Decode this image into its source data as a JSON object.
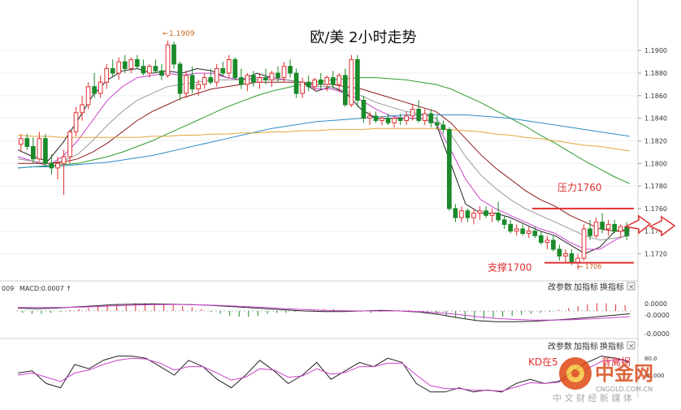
{
  "chart_data": {
    "type": "candlestick",
    "title": "欧/美 2小时走势",
    "y_axis_ticks": [
      "1.1900",
      "1.1880",
      "1.1860",
      "1.1840",
      "1.1820",
      "1.1800",
      "1.1780",
      "1.1760",
      "1.1740",
      "1.1720"
    ],
    "ylim": [
      1.1706,
      1.1916
    ],
    "high_label": "1.1909",
    "low_label": "1706",
    "candles_ohlc": [
      [
        1.1817,
        1.1826,
        1.181,
        1.1822
      ],
      [
        1.1822,
        1.1826,
        1.1812,
        1.1815
      ],
      [
        1.1815,
        1.1823,
        1.18,
        1.1804
      ],
      [
        1.1804,
        1.1828,
        1.1802,
        1.1822
      ],
      [
        1.1822,
        1.1826,
        1.1798,
        1.18
      ],
      [
        1.18,
        1.1808,
        1.179,
        1.1796
      ],
      [
        1.1796,
        1.1806,
        1.1786,
        1.18
      ],
      [
        1.18,
        1.1812,
        1.1772,
        1.1806
      ],
      [
        1.1806,
        1.183,
        1.18,
        1.1828
      ],
      [
        1.1828,
        1.185,
        1.1824,
        1.1845
      ],
      [
        1.1845,
        1.186,
        1.1838,
        1.1852
      ],
      [
        1.1852,
        1.1872,
        1.1848,
        1.1868
      ],
      [
        1.1868,
        1.188,
        1.1858,
        1.1862
      ],
      [
        1.1862,
        1.1878,
        1.1858,
        1.1872
      ],
      [
        1.1872,
        1.1888,
        1.1866,
        1.1884
      ],
      [
        1.1884,
        1.1892,
        1.1876,
        1.188
      ],
      [
        1.188,
        1.1894,
        1.1874,
        1.189
      ],
      [
        1.189,
        1.1896,
        1.188,
        1.1884
      ],
      [
        1.1884,
        1.1894,
        1.188,
        1.1892
      ],
      [
        1.1892,
        1.1896,
        1.1884,
        1.1886
      ],
      [
        1.1886,
        1.1892,
        1.1878,
        1.188
      ],
      [
        1.188,
        1.1888,
        1.1876,
        1.1886
      ],
      [
        1.1886,
        1.1892,
        1.188,
        1.1882
      ],
      [
        1.1882,
        1.1888,
        1.1874,
        1.1878
      ],
      [
        1.1878,
        1.1909,
        1.1876,
        1.1905
      ],
      [
        1.1905,
        1.1908,
        1.1884,
        1.1888
      ],
      [
        1.1888,
        1.189,
        1.1856,
        1.1862
      ],
      [
        1.1862,
        1.1882,
        1.1858,
        1.1878
      ],
      [
        1.1878,
        1.1886,
        1.1862,
        1.1866
      ],
      [
        1.1866,
        1.1874,
        1.186,
        1.187
      ],
      [
        1.187,
        1.188,
        1.1866,
        1.1876
      ],
      [
        1.1876,
        1.1884,
        1.187,
        1.1872
      ],
      [
        1.1872,
        1.1888,
        1.1868,
        1.1884
      ],
      [
        1.1884,
        1.189,
        1.1878,
        1.188
      ],
      [
        1.188,
        1.1896,
        1.1876,
        1.1892
      ],
      [
        1.1892,
        1.1894,
        1.1874,
        1.1876
      ],
      [
        1.1876,
        1.1884,
        1.1866,
        1.187
      ],
      [
        1.187,
        1.188,
        1.1864,
        1.1878
      ],
      [
        1.1878,
        1.1882,
        1.1868,
        1.1872
      ],
      [
        1.1872,
        1.188,
        1.1866,
        1.1876
      ],
      [
        1.1876,
        1.1884,
        1.187,
        1.1874
      ],
      [
        1.1874,
        1.1882,
        1.1868,
        1.188
      ],
      [
        1.188,
        1.1886,
        1.1872,
        1.1876
      ],
      [
        1.1876,
        1.189,
        1.1872,
        1.1886
      ],
      [
        1.1886,
        1.1892,
        1.1876,
        1.188
      ],
      [
        1.188,
        1.1884,
        1.1858,
        1.1862
      ],
      [
        1.1862,
        1.1876,
        1.1858,
        1.1872
      ],
      [
        1.1872,
        1.1878,
        1.1864,
        1.1868
      ],
      [
        1.1868,
        1.1876,
        1.1864,
        1.1874
      ],
      [
        1.1874,
        1.188,
        1.1866,
        1.187
      ],
      [
        1.187,
        1.1878,
        1.1864,
        1.1876
      ],
      [
        1.1876,
        1.1882,
        1.1866,
        1.187
      ],
      [
        1.187,
        1.188,
        1.1864,
        1.1878
      ],
      [
        1.1878,
        1.1884,
        1.185,
        1.1852
      ],
      [
        1.1852,
        1.1896,
        1.185,
        1.1892
      ],
      [
        1.1892,
        1.1896,
        1.185,
        1.1856
      ],
      [
        1.1856,
        1.186,
        1.1836,
        1.184
      ],
      [
        1.184,
        1.1846,
        1.1834,
        1.1842
      ],
      [
        1.1842,
        1.1846,
        1.1836,
        1.1838
      ],
      [
        1.1838,
        1.1842,
        1.1834,
        1.184
      ],
      [
        1.184,
        1.1844,
        1.1834,
        1.1836
      ],
      [
        1.1836,
        1.1842,
        1.1832,
        1.184
      ],
      [
        1.184,
        1.1844,
        1.1834,
        1.1838
      ],
      [
        1.1838,
        1.1846,
        1.1834,
        1.1842
      ],
      [
        1.1842,
        1.1852,
        1.1838,
        1.1848
      ],
      [
        1.1848,
        1.1856,
        1.1836,
        1.1838
      ],
      [
        1.1838,
        1.1848,
        1.1834,
        1.1844
      ],
      [
        1.1844,
        1.1848,
        1.1832,
        1.1836
      ],
      [
        1.1836,
        1.1842,
        1.183,
        1.1834
      ],
      [
        1.1834,
        1.1838,
        1.1826,
        1.183
      ],
      [
        1.183,
        1.1832,
        1.1758,
        1.176
      ],
      [
        1.176,
        1.1764,
        1.1748,
        1.1752
      ],
      [
        1.1752,
        1.1762,
        1.1748,
        1.1758
      ],
      [
        1.1758,
        1.176,
        1.1748,
        1.1752
      ],
      [
        1.1752,
        1.176,
        1.1746,
        1.1756
      ],
      [
        1.1756,
        1.1762,
        1.175,
        1.1758
      ],
      [
        1.1758,
        1.1762,
        1.1752,
        1.1754
      ],
      [
        1.1754,
        1.176,
        1.1748,
        1.1756
      ],
      [
        1.1756,
        1.1766,
        1.1748,
        1.175
      ],
      [
        1.175,
        1.1754,
        1.1742,
        1.1746
      ],
      [
        1.1746,
        1.175,
        1.1738,
        1.174
      ],
      [
        1.174,
        1.1746,
        1.1736,
        1.1742
      ],
      [
        1.1742,
        1.1746,
        1.1736,
        1.1738
      ],
      [
        1.1738,
        1.1744,
        1.1734,
        1.174
      ],
      [
        1.174,
        1.1744,
        1.1734,
        1.1736
      ],
      [
        1.1736,
        1.174,
        1.1728,
        1.173
      ],
      [
        1.173,
        1.1736,
        1.1724,
        1.1732
      ],
      [
        1.1732,
        1.1736,
        1.1722,
        1.1724
      ],
      [
        1.1724,
        1.1728,
        1.1714,
        1.1718
      ],
      [
        1.1718,
        1.1724,
        1.1712,
        1.172
      ],
      [
        1.172,
        1.1724,
        1.171,
        1.1712
      ],
      [
        1.1712,
        1.172,
        1.1706,
        1.1716
      ],
      [
        1.1716,
        1.1746,
        1.1714,
        1.1742
      ],
      [
        1.1742,
        1.175,
        1.1732,
        1.1736
      ],
      [
        1.1736,
        1.1752,
        1.1734,
        1.1748
      ],
      [
        1.1748,
        1.1756,
        1.1738,
        1.1742
      ],
      [
        1.1742,
        1.175,
        1.1736,
        1.1746
      ],
      [
        1.1746,
        1.175,
        1.1738,
        1.174
      ],
      [
        1.174,
        1.1746,
        1.1734,
        1.1744
      ],
      [
        1.1744,
        1.1748,
        1.1732,
        1.1736
      ]
    ],
    "moving_averages": [
      {
        "color": "#222222",
        "values": [
          1.1812,
          1.1806,
          1.1802,
          1.1818,
          1.1838,
          1.186,
          1.1874,
          1.1882,
          1.1884,
          1.188,
          1.1882,
          1.188,
          1.1884,
          1.1882,
          1.1876,
          1.1874,
          1.188,
          1.1876,
          1.1874,
          1.1872,
          1.1864,
          1.1868,
          1.1862,
          1.1848,
          1.184,
          1.184,
          1.184,
          1.184,
          1.1836,
          1.18,
          1.1764,
          1.1756,
          1.1756,
          1.1752,
          1.1746,
          1.174,
          1.1736,
          1.1728,
          1.172,
          1.1726,
          1.174,
          1.1742
        ]
      },
      {
        "color": "#cc44cc",
        "values": [
          1.1806,
          1.1802,
          1.1798,
          1.1806,
          1.182,
          1.1838,
          1.1856,
          1.1868,
          1.1876,
          1.1878,
          1.188,
          1.1878,
          1.188,
          1.188,
          1.1876,
          1.1874,
          1.1876,
          1.1876,
          1.1874,
          1.1872,
          1.1866,
          1.1866,
          1.1862,
          1.1856,
          1.1848,
          1.1842,
          1.184,
          1.184,
          1.1836,
          1.1812,
          1.1786,
          1.1768,
          1.176,
          1.1754,
          1.1748,
          1.1742,
          1.1738,
          1.173,
          1.1724,
          1.1724,
          1.1732,
          1.1738
        ]
      },
      {
        "color": "#999999",
        "values": [
          1.1804,
          1.1802,
          1.18,
          1.1802,
          1.1808,
          1.182,
          1.1834,
          1.1846,
          1.1856,
          1.1862,
          1.1868,
          1.187,
          1.1872,
          1.1874,
          1.1874,
          1.1874,
          1.1874,
          1.1874,
          1.1874,
          1.1872,
          1.1868,
          1.1868,
          1.1864,
          1.186,
          1.1854,
          1.185,
          1.1846,
          1.1844,
          1.184,
          1.1826,
          1.1806,
          1.179,
          1.1778,
          1.1768,
          1.176,
          1.1754,
          1.1748,
          1.1742,
          1.1736,
          1.1732,
          1.1734,
          1.1736
        ]
      },
      {
        "color": "#8b1a1a",
        "values": [
          1.18,
          1.18,
          1.18,
          1.1801,
          1.1804,
          1.181,
          1.1818,
          1.1828,
          1.1838,
          1.1846,
          1.1852,
          1.1858,
          1.1862,
          1.1866,
          1.1868,
          1.187,
          1.1872,
          1.1872,
          1.1872,
          1.1872,
          1.187,
          1.187,
          1.1868,
          1.1866,
          1.1862,
          1.1858,
          1.1854,
          1.185,
          1.1846,
          1.1836,
          1.1822,
          1.1808,
          1.1796,
          1.1786,
          1.1776,
          1.1768,
          1.1762,
          1.1754,
          1.1748,
          1.1742,
          1.174,
          1.174
        ]
      },
      {
        "color": "#2e9b2e",
        "values": [
          1.1796,
          1.1797,
          1.1798,
          1.1799,
          1.18,
          1.1803,
          1.1806,
          1.181,
          1.1815,
          1.182,
          1.1826,
          1.1832,
          1.1838,
          1.1844,
          1.185,
          1.1855,
          1.186,
          1.1864,
          1.1867,
          1.187,
          1.1872,
          1.1874,
          1.1875,
          1.1876,
          1.1876,
          1.1875,
          1.1874,
          1.1872,
          1.187,
          1.1866,
          1.186,
          1.1854,
          1.1847,
          1.184,
          1.1833,
          1.1825,
          1.1818,
          1.181,
          1.1802,
          1.1795,
          1.1788,
          1.1782
        ]
      },
      {
        "color": "#2e8bc9",
        "values": [
          1.1796,
          1.1797,
          1.1797,
          1.1798,
          1.1799,
          1.18,
          1.1801,
          1.1803,
          1.1805,
          1.1807,
          1.181,
          1.1813,
          1.1816,
          1.1819,
          1.1822,
          1.1825,
          1.1828,
          1.1831,
          1.1833,
          1.1835,
          1.1837,
          1.1838,
          1.1839,
          1.184,
          1.1841,
          1.1842,
          1.1843,
          1.1843,
          1.1843,
          1.1843,
          1.1843,
          1.1842,
          1.1841,
          1.184,
          1.1838,
          1.1836,
          1.1834,
          1.1832,
          1.183,
          1.1828,
          1.1826,
          1.1824
        ]
      },
      {
        "color": "#e3a53a",
        "values": [
          1.1825,
          1.1824,
          1.1824,
          1.1823,
          1.1823,
          1.1823,
          1.1823,
          1.1823,
          1.1823,
          1.1824,
          1.1824,
          1.1825,
          1.1825,
          1.1826,
          1.1826,
          1.1827,
          1.1827,
          1.1828,
          1.1828,
          1.1829,
          1.1829,
          1.183,
          1.183,
          1.183,
          1.1831,
          1.1831,
          1.1831,
          1.1831,
          1.1831,
          1.183,
          1.1829,
          1.1828,
          1.1826,
          1.1825,
          1.1823,
          1.1822,
          1.182,
          1.1818,
          1.1816,
          1.1815,
          1.1813,
          1.1811
        ]
      }
    ],
    "annotations": {
      "resistance_label": "压力1760",
      "resistance_value": 1.176,
      "support_label": "支撑1700",
      "support_value": 1.1712
    },
    "macd_panel": {
      "label": "MACD:0.0007 ↑",
      "prefix": "009",
      "ticks": [
        "0.0000",
        "-0.0000",
        "-0.0000"
      ],
      "zero_fraction": 0.42,
      "hist": [
        -0.2,
        -0.3,
        -0.3,
        -0.2,
        -0.1,
        0.1,
        0.2,
        0.3,
        0.5,
        0.6,
        0.7,
        0.7,
        0.8,
        0.8,
        0.7,
        0.7,
        0.6,
        0.5,
        0.4,
        0.2,
        -0.1,
        -0.3,
        -0.5,
        -0.6,
        -0.6,
        -0.5,
        -0.3,
        -0.2,
        -0.2,
        -0.1,
        0.0,
        0.1,
        0.2,
        0.2,
        0.1,
        0.0,
        -0.1,
        -0.2,
        -0.1,
        0.0,
        0.1,
        0.1,
        0.0,
        -0.1,
        -0.3,
        -0.5,
        -0.7,
        -0.8,
        -0.9,
        -0.8,
        -0.7,
        -0.6,
        -0.5,
        -0.4,
        -0.3,
        -0.2,
        -0.1,
        0.1,
        0.3,
        0.5,
        0.7,
        0.8,
        0.8,
        0.7,
        0.6
      ],
      "dif": [
        0.25,
        0.2,
        0.25,
        0.35,
        0.45,
        0.55,
        0.6,
        0.62,
        0.6,
        0.55,
        0.5,
        0.4,
        0.3,
        0.2,
        0.1,
        0.0,
        -0.05,
        -0.05,
        0.0,
        0.05,
        0.0,
        -0.1,
        -0.3,
        -0.6,
        -0.85,
        -0.95,
        -0.95,
        -0.9,
        -0.8,
        -0.7,
        -0.55,
        -0.4,
        -0.25
      ],
      "dea": [
        0.3,
        0.3,
        0.3,
        0.32,
        0.38,
        0.45,
        0.5,
        0.55,
        0.57,
        0.56,
        0.52,
        0.46,
        0.38,
        0.3,
        0.2,
        0.12,
        0.06,
        0.02,
        0.0,
        0.0,
        0.0,
        -0.05,
        -0.15,
        -0.3,
        -0.5,
        -0.65,
        -0.75,
        -0.8,
        -0.8,
        -0.77,
        -0.7,
        -0.6,
        -0.5
      ]
    },
    "kd_panel": {
      "label": "KD在5",
      "label_tail": "背离拐",
      "ticks": [
        "80.0",
        "50.000"
      ],
      "k": [
        0.55,
        0.6,
        0.3,
        0.2,
        0.75,
        0.65,
        0.85,
        0.95,
        0.95,
        0.9,
        0.7,
        0.5,
        0.85,
        0.7,
        0.4,
        0.2,
        0.5,
        0.85,
        0.6,
        0.3,
        0.5,
        0.8,
        0.4,
        0.6,
        0.8,
        0.7,
        0.9,
        0.8,
        0.3,
        0.1,
        0.1,
        0.2,
        0.1,
        0.15,
        0.1,
        0.3,
        0.4,
        0.3,
        0.35,
        0.6,
        0.8,
        0.95,
        0.9,
        0.8
      ],
      "d": [
        0.5,
        0.55,
        0.45,
        0.35,
        0.55,
        0.62,
        0.75,
        0.85,
        0.9,
        0.88,
        0.78,
        0.62,
        0.7,
        0.7,
        0.55,
        0.38,
        0.45,
        0.65,
        0.62,
        0.45,
        0.48,
        0.65,
        0.52,
        0.56,
        0.7,
        0.7,
        0.78,
        0.78,
        0.5,
        0.25,
        0.18,
        0.18,
        0.14,
        0.14,
        0.12,
        0.22,
        0.32,
        0.3,
        0.33,
        0.48,
        0.65,
        0.82,
        0.86,
        0.84
      ]
    }
  },
  "toolbar": {
    "change_params": "改参数",
    "add_indicator": "加指标",
    "swap_indicator": "换指标",
    "close": "×"
  },
  "watermark": {
    "brand": "中金网",
    "url": "CNGOLD.COM.CN",
    "slogan": "中 文 财 经 新 媒 体"
  }
}
